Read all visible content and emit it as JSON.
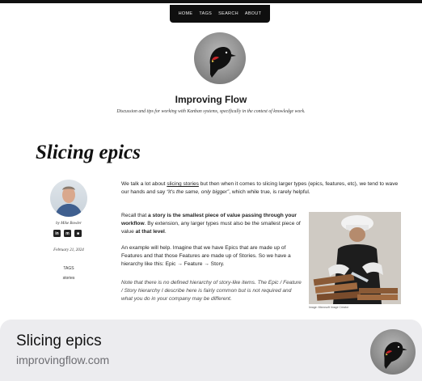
{
  "nav": {
    "items": [
      "HOME",
      "TAGS",
      "SEARCH",
      "ABOUT"
    ]
  },
  "site": {
    "logo_icon": "red-winged-blackbird-logo",
    "title": "Improving Flow",
    "tagline": "Discussion and tips for working with Kanban systems, specifically in the context of knowledge work."
  },
  "post": {
    "title": "Slicing epics",
    "author": "by Mike Bowler",
    "social_icons": [
      "linkedin-icon",
      "mastodon-icon",
      "profile-card-icon"
    ],
    "date": "February 21, 2024",
    "tags_label": "TAGS",
    "tags": [
      "stories"
    ],
    "paragraphs": {
      "p1": {
        "a": "We talk a lot about ",
        "link": "slicing stories",
        "b": " but then when it comes to slicing larger types (epics, features, etc), we tend to wave our hands and say ",
        "quote": "“it's the same, only bigger”",
        "c": ", which while true, is rarely helpful."
      },
      "p2": {
        "a": "Recall that ",
        "bold1": "a story is the smallest piece of value passing through your workflow",
        "b": ". By extension, any larger types must also be the smallest piece of value ",
        "bold2": "at that level",
        "c": "."
      },
      "p3": "An example will help. Imagine that we have Epics that are made up of Features and that those Features are made up of Stories. So we have a hierarchy like this: Epic → Feature → Story.",
      "p4": "Note that there is no defined hierarchy of story-like items. The Epic / Feature / Story hierarchy I describe here is fairly common but is not required and what you do in your company may be different.",
      "image_caption": "Image: Microsoft Image Creator"
    }
  },
  "share_card": {
    "title": "Slicing epics",
    "domain": "improvingflow.com",
    "icon": "red-winged-blackbird-logo"
  }
}
